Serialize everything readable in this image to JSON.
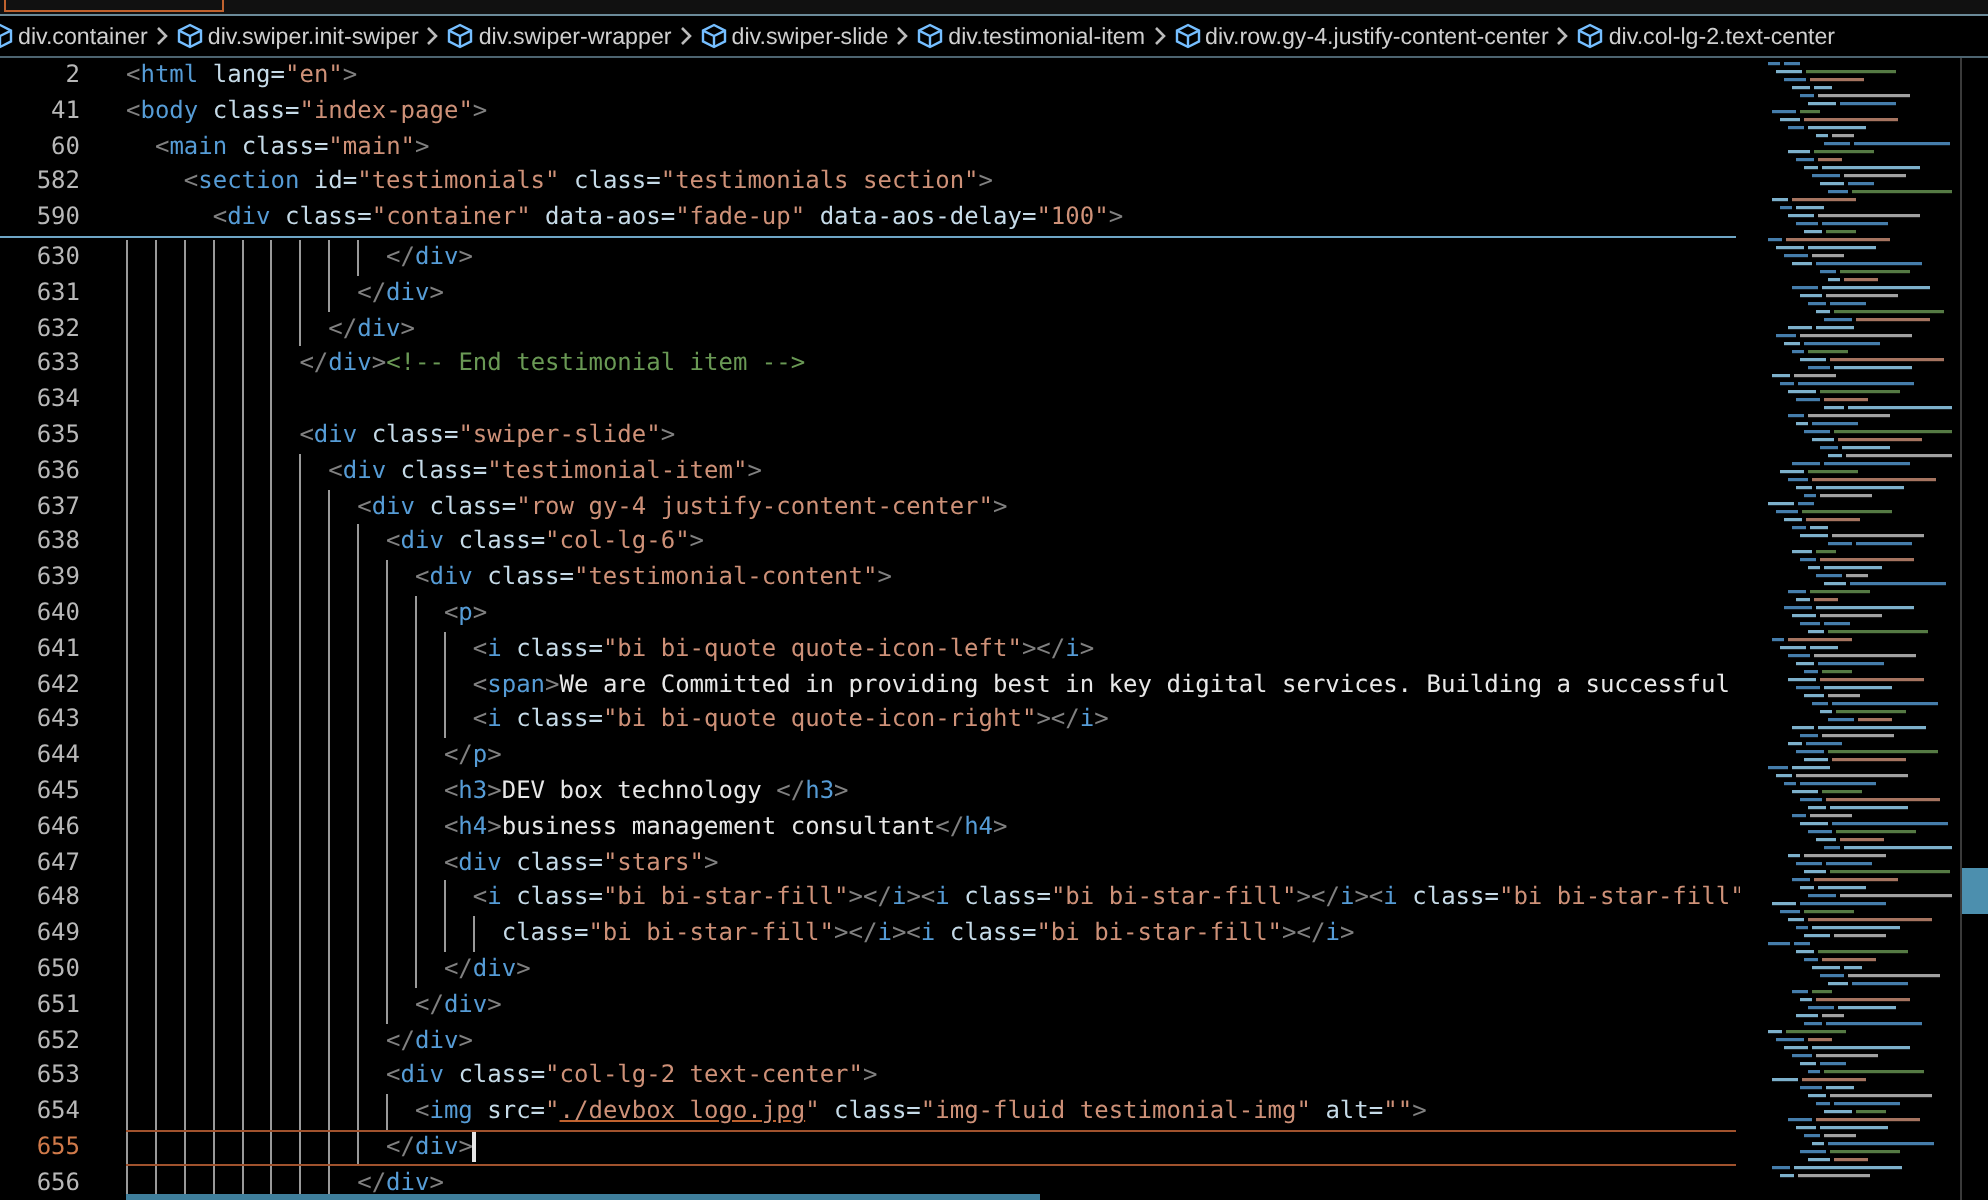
{
  "breadcrumbs": [
    "div.container",
    "div.swiper.init-swiper",
    "div.swiper-wrapper",
    "div.swiper-slide",
    "div.testimonial-item",
    "div.row.gy-4.justify-content-center",
    "div.col-lg-2.text-center"
  ],
  "sticky_lines": [
    {
      "number": "2",
      "tokens": [
        {
          "kind": "p",
          "text": "<"
        },
        {
          "kind": "t",
          "text": "html"
        },
        {
          "kind": "a",
          "text": " lang="
        },
        {
          "kind": "s",
          "text": "\"en\""
        },
        {
          "kind": "p",
          "text": ">"
        }
      ]
    },
    {
      "number": "41",
      "tokens": [
        {
          "kind": "p",
          "text": "<"
        },
        {
          "kind": "t",
          "text": "body"
        },
        {
          "kind": "a",
          "text": " class="
        },
        {
          "kind": "s",
          "text": "\"index-page\""
        },
        {
          "kind": "p",
          "text": ">"
        }
      ]
    },
    {
      "number": "60",
      "tokens": [
        {
          "kind": "p",
          "text": "  <"
        },
        {
          "kind": "t",
          "text": "main"
        },
        {
          "kind": "a",
          "text": " class="
        },
        {
          "kind": "s",
          "text": "\"main\""
        },
        {
          "kind": "p",
          "text": ">"
        }
      ]
    },
    {
      "number": "582",
      "tokens": [
        {
          "kind": "p",
          "text": "    <"
        },
        {
          "kind": "t",
          "text": "section"
        },
        {
          "kind": "a",
          "text": " id="
        },
        {
          "kind": "s",
          "text": "\"testimonials\""
        },
        {
          "kind": "a",
          "text": " class="
        },
        {
          "kind": "s",
          "text": "\"testimonials section\""
        },
        {
          "kind": "p",
          "text": ">"
        }
      ]
    },
    {
      "number": "590",
      "tokens": [
        {
          "kind": "p",
          "text": "      <"
        },
        {
          "kind": "t",
          "text": "div"
        },
        {
          "kind": "a",
          "text": " class="
        },
        {
          "kind": "s",
          "text": "\"container\""
        },
        {
          "kind": "a",
          "text": " data-aos="
        },
        {
          "kind": "s",
          "text": "\"fade-up\""
        },
        {
          "kind": "a",
          "text": " data-aos-delay="
        },
        {
          "kind": "s",
          "text": "\"100\""
        },
        {
          "kind": "p",
          "text": ">"
        }
      ]
    }
  ],
  "lines": [
    {
      "number": "630",
      "current": false,
      "tokens": [
        {
          "kind": "p",
          "text": "                  </"
        },
        {
          "kind": "t",
          "text": "div"
        },
        {
          "kind": "p",
          "text": ">"
        }
      ]
    },
    {
      "number": "631",
      "current": false,
      "tokens": [
        {
          "kind": "p",
          "text": "                </"
        },
        {
          "kind": "t",
          "text": "div"
        },
        {
          "kind": "p",
          "text": ">"
        }
      ]
    },
    {
      "number": "632",
      "current": false,
      "tokens": [
        {
          "kind": "p",
          "text": "              </"
        },
        {
          "kind": "t",
          "text": "div"
        },
        {
          "kind": "p",
          "text": ">"
        }
      ]
    },
    {
      "number": "633",
      "current": false,
      "tokens": [
        {
          "kind": "p",
          "text": "            </"
        },
        {
          "kind": "t",
          "text": "div"
        },
        {
          "kind": "p",
          "text": ">"
        },
        {
          "kind": "c",
          "text": "<!-- End testimonial item -->"
        }
      ]
    },
    {
      "number": "634",
      "current": false
    },
    {
      "number": "635",
      "current": false,
      "tokens": [
        {
          "kind": "p",
          "text": "            <"
        },
        {
          "kind": "t",
          "text": "div"
        },
        {
          "kind": "a",
          "text": " class="
        },
        {
          "kind": "s",
          "text": "\"swiper-slide\""
        },
        {
          "kind": "p",
          "text": ">"
        }
      ]
    },
    {
      "number": "636",
      "current": false,
      "tokens": [
        {
          "kind": "p",
          "text": "              <"
        },
        {
          "kind": "t",
          "text": "div"
        },
        {
          "kind": "a",
          "text": " class="
        },
        {
          "kind": "s",
          "text": "\"testimonial-item\""
        },
        {
          "kind": "p",
          "text": ">"
        }
      ]
    },
    {
      "number": "637",
      "current": false,
      "tokens": [
        {
          "kind": "p",
          "text": "                <"
        },
        {
          "kind": "t",
          "text": "div"
        },
        {
          "kind": "a",
          "text": " class="
        },
        {
          "kind": "s",
          "text": "\"row gy-4 justify-content-center\""
        },
        {
          "kind": "p",
          "text": ">"
        }
      ]
    },
    {
      "number": "638",
      "current": false,
      "tokens": [
        {
          "kind": "p",
          "text": "                  <"
        },
        {
          "kind": "t",
          "text": "div"
        },
        {
          "kind": "a",
          "text": " class="
        },
        {
          "kind": "s",
          "text": "\"col-lg-6\""
        },
        {
          "kind": "p",
          "text": ">"
        }
      ]
    },
    {
      "number": "639",
      "current": false,
      "tokens": [
        {
          "kind": "p",
          "text": "                    <"
        },
        {
          "kind": "t",
          "text": "div"
        },
        {
          "kind": "a",
          "text": " class="
        },
        {
          "kind": "s",
          "text": "\"testimonial-content\""
        },
        {
          "kind": "p",
          "text": ">"
        }
      ]
    },
    {
      "number": "640",
      "current": false,
      "tokens": [
        {
          "kind": "p",
          "text": "                      <"
        },
        {
          "kind": "t",
          "text": "p"
        },
        {
          "kind": "p",
          "text": ">"
        }
      ]
    },
    {
      "number": "641",
      "current": false,
      "tokens": [
        {
          "kind": "p",
          "text": "                        <"
        },
        {
          "kind": "t",
          "text": "i"
        },
        {
          "kind": "a",
          "text": " class="
        },
        {
          "kind": "s",
          "text": "\"bi bi-quote quote-icon-left\""
        },
        {
          "kind": "p",
          "text": "></"
        },
        {
          "kind": "t",
          "text": "i"
        },
        {
          "kind": "p",
          "text": ">"
        }
      ]
    },
    {
      "number": "642",
      "current": false,
      "tokens": [
        {
          "kind": "p",
          "text": "                        <"
        },
        {
          "kind": "t",
          "text": "span"
        },
        {
          "kind": "p",
          "text": ">"
        },
        {
          "kind": "x",
          "text": "We are Committed in providing best in key digital services. Building a successful"
        }
      ]
    },
    {
      "number": "643",
      "current": false,
      "tokens": [
        {
          "kind": "p",
          "text": "                        <"
        },
        {
          "kind": "t",
          "text": "i"
        },
        {
          "kind": "a",
          "text": " class="
        },
        {
          "kind": "s",
          "text": "\"bi bi-quote quote-icon-right\""
        },
        {
          "kind": "p",
          "text": "></"
        },
        {
          "kind": "t",
          "text": "i"
        },
        {
          "kind": "p",
          "text": ">"
        }
      ]
    },
    {
      "number": "644",
      "current": false,
      "tokens": [
        {
          "kind": "p",
          "text": "                      </"
        },
        {
          "kind": "t",
          "text": "p"
        },
        {
          "kind": "p",
          "text": ">"
        }
      ]
    },
    {
      "number": "645",
      "current": false,
      "tokens": [
        {
          "kind": "p",
          "text": "                      <"
        },
        {
          "kind": "t",
          "text": "h3"
        },
        {
          "kind": "p",
          "text": ">"
        },
        {
          "kind": "x",
          "text": "DEV box technology "
        },
        {
          "kind": "p",
          "text": "</"
        },
        {
          "kind": "t",
          "text": "h3"
        },
        {
          "kind": "p",
          "text": ">"
        }
      ]
    },
    {
      "number": "646",
      "current": false,
      "tokens": [
        {
          "kind": "p",
          "text": "                      <"
        },
        {
          "kind": "t",
          "text": "h4"
        },
        {
          "kind": "p",
          "text": ">"
        },
        {
          "kind": "x",
          "text": "business management consultant"
        },
        {
          "kind": "p",
          "text": "</"
        },
        {
          "kind": "t",
          "text": "h4"
        },
        {
          "kind": "p",
          "text": ">"
        }
      ]
    },
    {
      "number": "647",
      "current": false,
      "tokens": [
        {
          "kind": "p",
          "text": "                      <"
        },
        {
          "kind": "t",
          "text": "div"
        },
        {
          "kind": "a",
          "text": " class="
        },
        {
          "kind": "s",
          "text": "\"stars\""
        },
        {
          "kind": "p",
          "text": ">"
        }
      ]
    },
    {
      "number": "648",
      "current": false,
      "tokens": [
        {
          "kind": "p",
          "text": "                        <"
        },
        {
          "kind": "t",
          "text": "i"
        },
        {
          "kind": "a",
          "text": " class="
        },
        {
          "kind": "s",
          "text": "\"bi bi-star-fill\""
        },
        {
          "kind": "p",
          "text": "></"
        },
        {
          "kind": "t",
          "text": "i"
        },
        {
          "kind": "p",
          "text": "><"
        },
        {
          "kind": "t",
          "text": "i"
        },
        {
          "kind": "a",
          "text": " class="
        },
        {
          "kind": "s",
          "text": "\"bi bi-star-fill\""
        },
        {
          "kind": "p",
          "text": "></"
        },
        {
          "kind": "t",
          "text": "i"
        },
        {
          "kind": "p",
          "text": "><"
        },
        {
          "kind": "t",
          "text": "i"
        },
        {
          "kind": "a",
          "text": " class="
        },
        {
          "kind": "s",
          "text": "\"bi bi-star-fill\""
        }
      ]
    },
    {
      "number": "649",
      "current": false,
      "tokens": [
        {
          "kind": "a",
          "text": "                          class="
        },
        {
          "kind": "s",
          "text": "\"bi bi-star-fill\""
        },
        {
          "kind": "p",
          "text": "></"
        },
        {
          "kind": "t",
          "text": "i"
        },
        {
          "kind": "p",
          "text": "><"
        },
        {
          "kind": "t",
          "text": "i"
        },
        {
          "kind": "a",
          "text": " class="
        },
        {
          "kind": "s",
          "text": "\"bi bi-star-fill\""
        },
        {
          "kind": "p",
          "text": "></"
        },
        {
          "kind": "t",
          "text": "i"
        },
        {
          "kind": "p",
          "text": ">"
        }
      ]
    },
    {
      "number": "650",
      "current": false,
      "tokens": [
        {
          "kind": "p",
          "text": "                      </"
        },
        {
          "kind": "t",
          "text": "div"
        },
        {
          "kind": "p",
          "text": ">"
        }
      ]
    },
    {
      "number": "651",
      "current": false,
      "tokens": [
        {
          "kind": "p",
          "text": "                    </"
        },
        {
          "kind": "t",
          "text": "div"
        },
        {
          "kind": "p",
          "text": ">"
        }
      ]
    },
    {
      "number": "652",
      "current": false,
      "tokens": [
        {
          "kind": "p",
          "text": "                  </"
        },
        {
          "kind": "t",
          "text": "div"
        },
        {
          "kind": "p",
          "text": ">"
        }
      ]
    },
    {
      "number": "653",
      "current": false,
      "tokens": [
        {
          "kind": "p",
          "text": "                  <"
        },
        {
          "kind": "t",
          "text": "div"
        },
        {
          "kind": "a",
          "text": " class="
        },
        {
          "kind": "s",
          "text": "\"col-lg-2 text-center\""
        },
        {
          "kind": "p",
          "text": ">"
        }
      ]
    },
    {
      "number": "654",
      "current": false,
      "tokens": [
        {
          "kind": "p",
          "text": "                    <"
        },
        {
          "kind": "t",
          "text": "img"
        },
        {
          "kind": "a",
          "text": " src="
        },
        {
          "kind": "s",
          "text": "\""
        },
        {
          "kind": "l",
          "text": "./devbox logo.jpg"
        },
        {
          "kind": "s",
          "text": "\""
        },
        {
          "kind": "a",
          "text": " class="
        },
        {
          "kind": "s",
          "text": "\"img-fluid testimonial-img\""
        },
        {
          "kind": "a",
          "text": " alt="
        },
        {
          "kind": "s",
          "text": "\"\""
        },
        {
          "kind": "p",
          "text": ">"
        }
      ]
    },
    {
      "number": "655",
      "current": true,
      "tokens": [
        {
          "kind": "p",
          "text": "                  </"
        },
        {
          "kind": "t",
          "text": "div"
        },
        {
          "kind": "p",
          "text": ">"
        }
      ]
    },
    {
      "number": "656",
      "current": false,
      "tokens": [
        {
          "kind": "p",
          "text": "                </"
        },
        {
          "kind": "t",
          "text": "div"
        },
        {
          "kind": "p",
          "text": ">"
        }
      ]
    }
  ]
}
